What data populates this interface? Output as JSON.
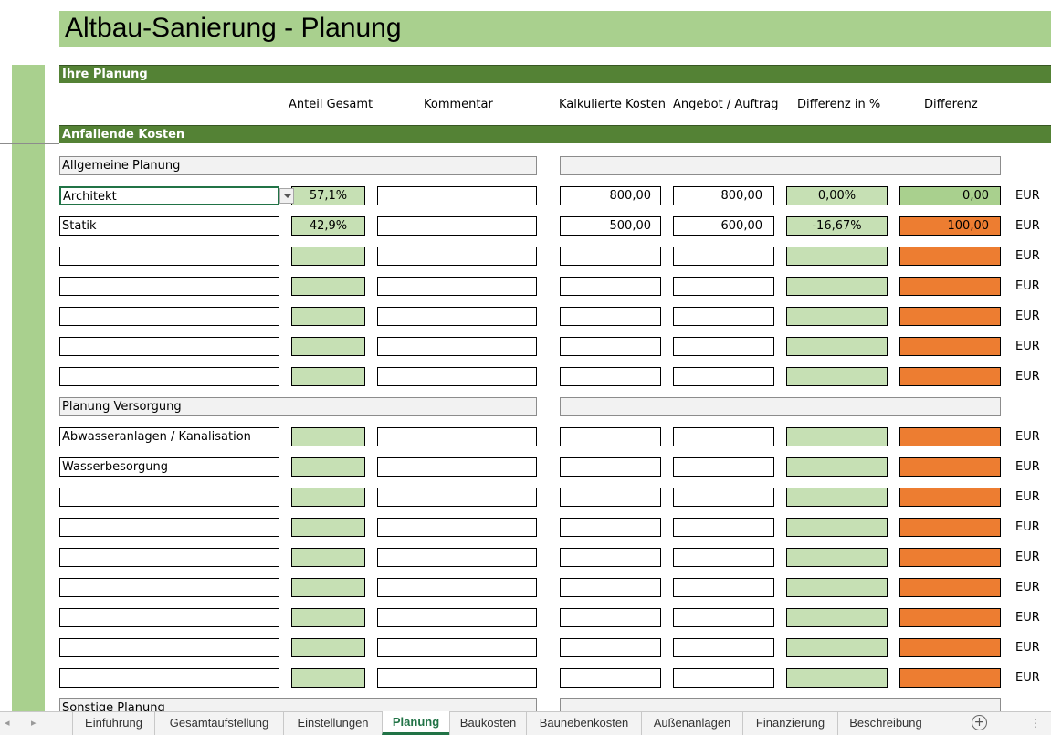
{
  "title": "Altbau-Sanierung - Planung",
  "sections": {
    "ihre_planung": "Ihre Planung",
    "anfallende_kosten": "Anfallende Kosten"
  },
  "columns": {
    "anteil": "Anteil Gesamt",
    "kommentar": "Kommentar",
    "kalkuliert": "Kalkulierte Kosten",
    "angebot": "Angebot / Auftrag",
    "diff_pct": "Differenz in %",
    "diff": "Differenz"
  },
  "currency": "EUR",
  "categories": [
    {
      "label": "Allgemeine Planung",
      "rows": [
        {
          "name": "Architekt",
          "anteil": "57,1%",
          "kommentar": "",
          "kalk": "800,00",
          "angebot": "800,00",
          "diff_pct": "0,00%",
          "diff": "0,00"
        },
        {
          "name": "Statik",
          "anteil": "42,9%",
          "kommentar": "",
          "kalk": "500,00",
          "angebot": "600,00",
          "diff_pct": "-16,67%",
          "diff": "100,00"
        },
        {
          "name": "",
          "anteil": "",
          "kommentar": "",
          "kalk": "",
          "angebot": "",
          "diff_pct": "",
          "diff": ""
        },
        {
          "name": "",
          "anteil": "",
          "kommentar": "",
          "kalk": "",
          "angebot": "",
          "diff_pct": "",
          "diff": ""
        },
        {
          "name": "",
          "anteil": "",
          "kommentar": "",
          "kalk": "",
          "angebot": "",
          "diff_pct": "",
          "diff": ""
        },
        {
          "name": "",
          "anteil": "",
          "kommentar": "",
          "kalk": "",
          "angebot": "",
          "diff_pct": "",
          "diff": ""
        },
        {
          "name": "",
          "anteil": "",
          "kommentar": "",
          "kalk": "",
          "angebot": "",
          "diff_pct": "",
          "diff": ""
        }
      ]
    },
    {
      "label": "Planung Versorgung",
      "rows": [
        {
          "name": "Abwasseranlagen / Kanalisation",
          "anteil": "",
          "kommentar": "",
          "kalk": "",
          "angebot": "",
          "diff_pct": "",
          "diff": ""
        },
        {
          "name": "Wasserbesorgung",
          "anteil": "",
          "kommentar": "",
          "kalk": "",
          "angebot": "",
          "diff_pct": "",
          "diff": ""
        },
        {
          "name": "",
          "anteil": "",
          "kommentar": "",
          "kalk": "",
          "angebot": "",
          "diff_pct": "",
          "diff": ""
        },
        {
          "name": "",
          "anteil": "",
          "kommentar": "",
          "kalk": "",
          "angebot": "",
          "diff_pct": "",
          "diff": ""
        },
        {
          "name": "",
          "anteil": "",
          "kommentar": "",
          "kalk": "",
          "angebot": "",
          "diff_pct": "",
          "diff": ""
        },
        {
          "name": "",
          "anteil": "",
          "kommentar": "",
          "kalk": "",
          "angebot": "",
          "diff_pct": "",
          "diff": ""
        },
        {
          "name": "",
          "anteil": "",
          "kommentar": "",
          "kalk": "",
          "angebot": "",
          "diff_pct": "",
          "diff": ""
        },
        {
          "name": "",
          "anteil": "",
          "kommentar": "",
          "kalk": "",
          "angebot": "",
          "diff_pct": "",
          "diff": ""
        },
        {
          "name": "",
          "anteil": "",
          "kommentar": "",
          "kalk": "",
          "angebot": "",
          "diff_pct": "",
          "diff": ""
        }
      ]
    },
    {
      "label": "Sonstige Planung",
      "rows": []
    }
  ],
  "tabs": [
    {
      "label": "Einführung",
      "active": false
    },
    {
      "label": "Gesamtaufstellung",
      "active": false
    },
    {
      "label": "Einstellungen",
      "active": false
    },
    {
      "label": "Planung",
      "active": true
    },
    {
      "label": "Baukosten",
      "active": false
    },
    {
      "label": "Baunebenkosten",
      "active": false
    },
    {
      "label": "Außenanlagen",
      "active": false
    },
    {
      "label": "Finanzierung",
      "active": false
    },
    {
      "label": "Beschreibung",
      "active": false
    }
  ],
  "colors": {
    "title_bg": "#a9d08e",
    "header_bg": "#548235",
    "pct_cell": "#c6e0b4",
    "diff_negative": "#ed7d31",
    "diff_ok": "#a9d08e",
    "accent": "#217346"
  },
  "icons": {
    "add_sheet": "plus-circle-icon",
    "dropdown": "chevron-down-icon"
  }
}
